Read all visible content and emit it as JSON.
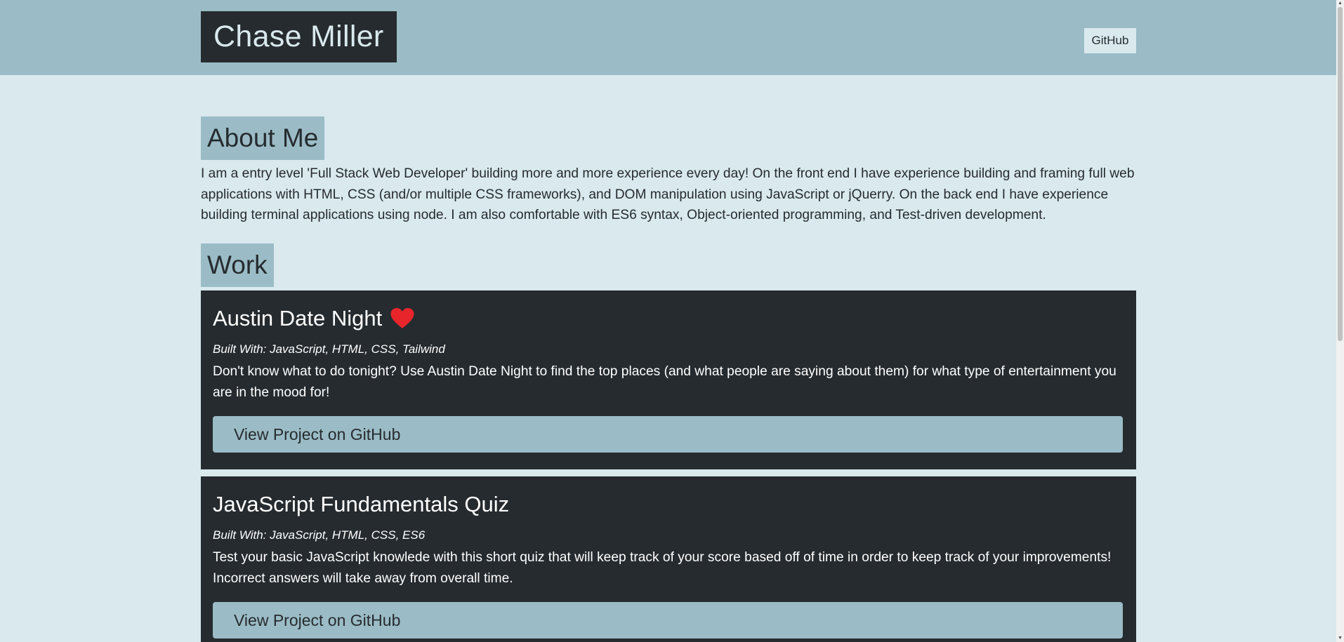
{
  "header": {
    "brand": "Chase Miller",
    "nav_link": "GitHub"
  },
  "about": {
    "heading": "About Me",
    "text": "I am a entry level 'Full Stack Web Developer' building more and more experience every day! On the front end I have experience building and framing full web applications with HTML, CSS (and/or multiple CSS frameworks), and DOM manipulation using JavaScript or jQuerry. On the back end I have experience building terminal applications using node. I am also comfortable with ES6 syntax, Object-oriented programming, and Test-driven development."
  },
  "work": {
    "heading": "Work",
    "projects": [
      {
        "title": "Austin Date Night",
        "icon": "heart-icon",
        "built_with": "Built With: JavaScript, HTML, CSS, Tailwind",
        "description": "Don't know what to do tonight? Use Austin Date Night to find the top places (and what people are saying about them) for what type of entertainment you are in the mood for!",
        "button_label": "View Project on GitHub"
      },
      {
        "title": "JavaScript Fundamentals Quiz",
        "built_with": "Built With: JavaScript, HTML, CSS, ES6",
        "description": "Test your basic JavaScript knowlede with this short quiz that will keep track of your score based off of time in order to keep track of your improvements! Incorrect answers will take away from overall time.",
        "button_label": "View Project on GitHub"
      }
    ]
  },
  "colors": {
    "background": "#d9e9ee",
    "header": "#9bbcc6",
    "dark": "#262b2f",
    "heart": "#e8252b"
  }
}
